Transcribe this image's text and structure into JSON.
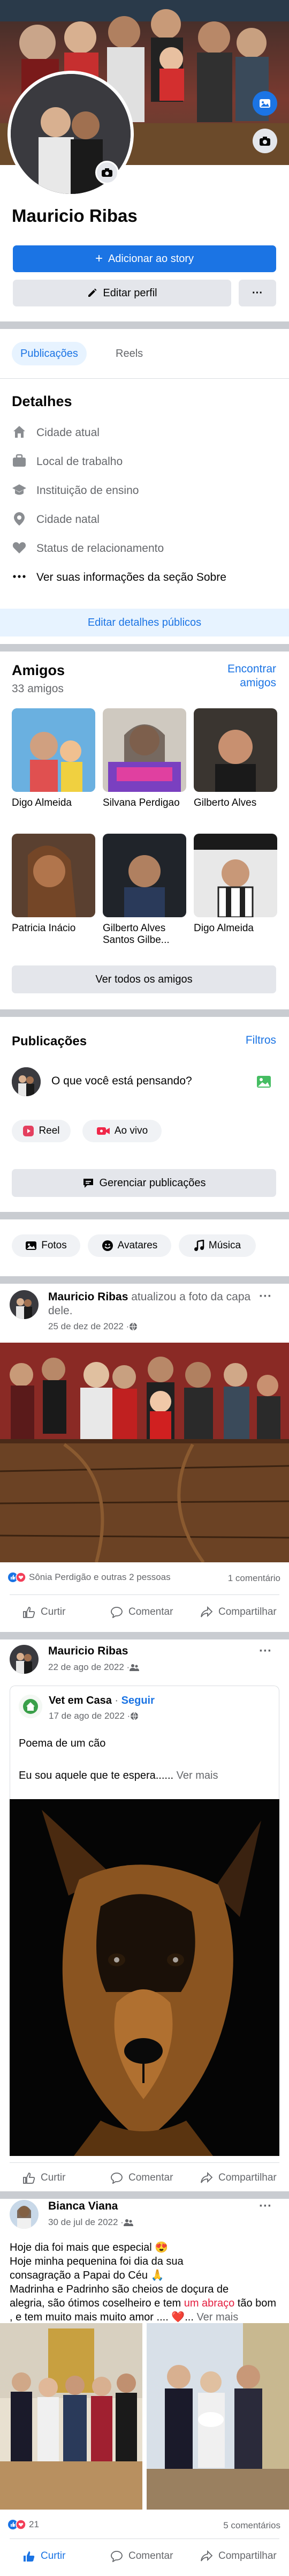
{
  "profile": {
    "name": "Mauricio Ribas",
    "add_story": "Adicionar ao story",
    "edit_profile": "Editar perfil",
    "more": "···"
  },
  "tabs": {
    "posts": "Publicações",
    "reels": "Reels"
  },
  "details": {
    "title": "Detalhes",
    "items": [
      {
        "icon": "house-icon",
        "label": "Cidade atual"
      },
      {
        "icon": "briefcase-icon",
        "label": "Local de trabalho"
      },
      {
        "icon": "graduation-cap-icon",
        "label": "Instituição de ensino"
      },
      {
        "icon": "location-pin-icon",
        "label": "Cidade natal"
      },
      {
        "icon": "heart-icon",
        "label": "Status de relacionamento"
      },
      {
        "icon": "more-dots-icon",
        "label": "Ver suas informações da seção Sobre"
      }
    ],
    "edit_button": "Editar detalhes públicos"
  },
  "friends": {
    "title": "Amigos",
    "count": "33 amigos",
    "find_line1": "Encontrar",
    "find_line2": "amigos",
    "list": [
      {
        "name": "Digo Almeida"
      },
      {
        "name": "Silvana Perdigao"
      },
      {
        "name": "Gilberto Alves"
      },
      {
        "name": "Patricia Inácio"
      },
      {
        "name": "Gilberto Alves Santos Gilbe..."
      },
      {
        "name": "Digo Almeida"
      }
    ],
    "see_all": "Ver todos os amigos"
  },
  "publications": {
    "title": "Publicações",
    "filters": "Filtros",
    "composer_placeholder": "O que você está pensando?",
    "reel": "Reel",
    "live": "Ao vivo",
    "manage": "Gerenciar publicações",
    "chips": [
      "Fotos",
      "Avatares",
      "Música"
    ]
  },
  "posts": [
    {
      "author": "Mauricio Ribas",
      "action_text": " atualizou a foto da capa dele.",
      "date": "25 de dez de 2022 · ",
      "reactions_text": "Sônia Perdigão e outras 2 pessoas",
      "comments": "1 comentário"
    },
    {
      "author": "Mauricio Ribas",
      "date": "22 de ago de 2022 · ",
      "shared_page": "Vet em Casa",
      "follow": "Seguir",
      "shared_date": "17 de ago de 2022 · ",
      "shared_title": "Poema de um cão",
      "shared_text": "Eu sou aquele que te espera......",
      "see_more": "Ver mais"
    },
    {
      "author": "Bianca Viana",
      "date": "30 de jul de 2022 · ",
      "text_line1": "Hoje dia foi mais que especial 😍",
      "text_line2": "Hoje minha pequenina foi dia da sua",
      "text_line3": "consagração a Papai do Céu 🙏",
      "text_line4": "Madrinha e Padrinho são cheios de doçura de",
      "text_line5": "alegria, são ótimos coselheiro e tem ",
      "text_highlight": "um abraço",
      "text_line6": " tão bom , e tem muito mais muito amor .... ❤️... ",
      "see_more": "Ver mais",
      "reactions_count": "21",
      "comments": "5 comentários"
    }
  ],
  "actions": {
    "like": "Curtir",
    "comment": "Comentar",
    "share": "Compartilhar"
  },
  "colors": {
    "accent": "#1b74e4",
    "separator": "#c9ccd1",
    "muted": "#65676b"
  }
}
